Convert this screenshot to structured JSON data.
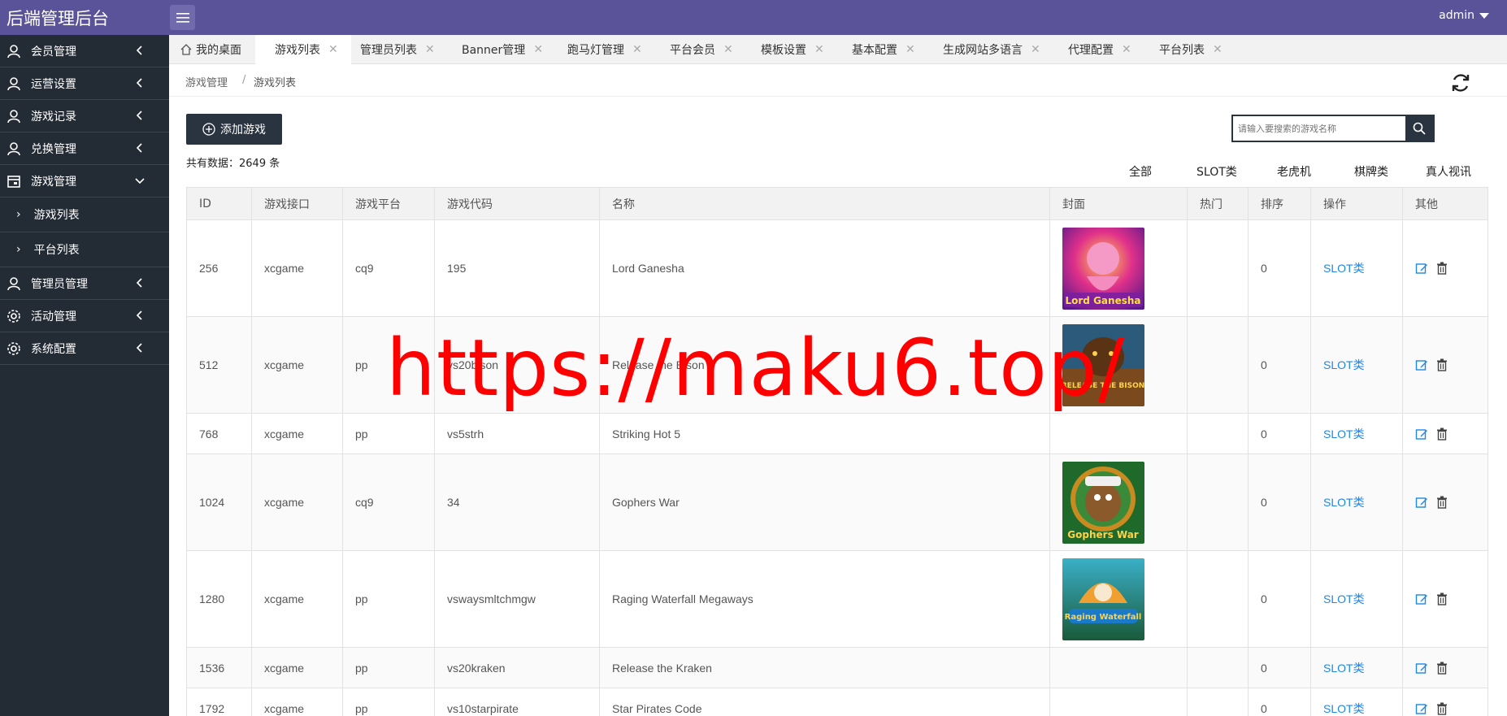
{
  "header": {
    "brand": "后端管理后台",
    "user": "admin"
  },
  "sidebar": {
    "items": [
      {
        "label": "会员管理",
        "icon": "user-icon"
      },
      {
        "label": "运营设置",
        "icon": "user-icon"
      },
      {
        "label": "游戏记录",
        "icon": "user-icon"
      },
      {
        "label": "兑换管理",
        "icon": "user-icon"
      },
      {
        "label": "游戏管理",
        "icon": "calendar-icon"
      },
      {
        "label": "管理员管理",
        "icon": "user-icon"
      },
      {
        "label": "活动管理",
        "icon": "gear-icon"
      },
      {
        "label": "系统配置",
        "icon": "gear-icon"
      }
    ],
    "sub_items": [
      {
        "label": "游戏列表"
      },
      {
        "label": "平台列表"
      }
    ]
  },
  "tabs": [
    {
      "label": "我的桌面"
    },
    {
      "label": "游戏列表"
    },
    {
      "label": "管理员列表"
    },
    {
      "label": "Banner管理"
    },
    {
      "label": "跑马灯管理"
    },
    {
      "label": "平台会员"
    },
    {
      "label": "模板设置"
    },
    {
      "label": "基本配置"
    },
    {
      "label": "生成网站多语言"
    },
    {
      "label": "代理配置"
    },
    {
      "label": "平台列表"
    }
  ],
  "breadcrumb": {
    "parent": "游戏管理",
    "separator": "/",
    "current": "游戏列表"
  },
  "toolbar": {
    "add_label": "添加游戏",
    "count_text": "共有数据：2649 条",
    "search_placeholder": "请输入要搜索的游戏名称"
  },
  "filters": [
    "全部",
    "SLOT类",
    "老虎机",
    "棋牌类",
    "真人视讯"
  ],
  "table": {
    "headers": [
      "ID",
      "游戏接口",
      "游戏平台",
      "游戏代码",
      "名称",
      "封面",
      "热门",
      "排序",
      "操作",
      "其他"
    ],
    "rows": [
      {
        "id": "256",
        "api": "xcgame",
        "platform": "cq9",
        "code": "195",
        "name": "Lord Ganesha",
        "cover_text": "Lord Ganesha",
        "hot": "",
        "sort": "0",
        "op": "SLOT类"
      },
      {
        "id": "512",
        "api": "xcgame",
        "platform": "pp",
        "code": "vs20bison",
        "name": "Release the Bison",
        "cover_text": "RELEASE THE BISON",
        "hot": "",
        "sort": "0",
        "op": "SLOT类"
      },
      {
        "id": "768",
        "api": "xcgame",
        "platform": "pp",
        "code": "vs5strh",
        "name": "Striking Hot 5",
        "cover_text": "",
        "hot": "",
        "sort": "0",
        "op": "SLOT类"
      },
      {
        "id": "1024",
        "api": "xcgame",
        "platform": "cq9",
        "code": "34",
        "name": "Gophers War",
        "cover_text": "Gophers War",
        "hot": "",
        "sort": "0",
        "op": "SLOT类"
      },
      {
        "id": "1280",
        "api": "xcgame",
        "platform": "pp",
        "code": "vswaysmltchmgw",
        "name": "Raging Waterfall Megaways",
        "cover_text": "Raging Waterfall",
        "hot": "",
        "sort": "0",
        "op": "SLOT类"
      },
      {
        "id": "1536",
        "api": "xcgame",
        "platform": "pp",
        "code": "vs20kraken",
        "name": "Release the Kraken",
        "cover_text": "",
        "hot": "",
        "sort": "0",
        "op": "SLOT类"
      },
      {
        "id": "1792",
        "api": "xcgame",
        "platform": "pp",
        "code": "vs10starpirate",
        "name": "Star Pirates Code",
        "cover_text": "",
        "hot": "",
        "sort": "0",
        "op": "SLOT类"
      }
    ]
  },
  "watermark": "https://maku6.top/",
  "colors": {
    "header": "#5a539a",
    "sidebar": "#232b35",
    "button": "#2a3440",
    "link": "#1e88e5",
    "watermark": "#ff0000"
  }
}
